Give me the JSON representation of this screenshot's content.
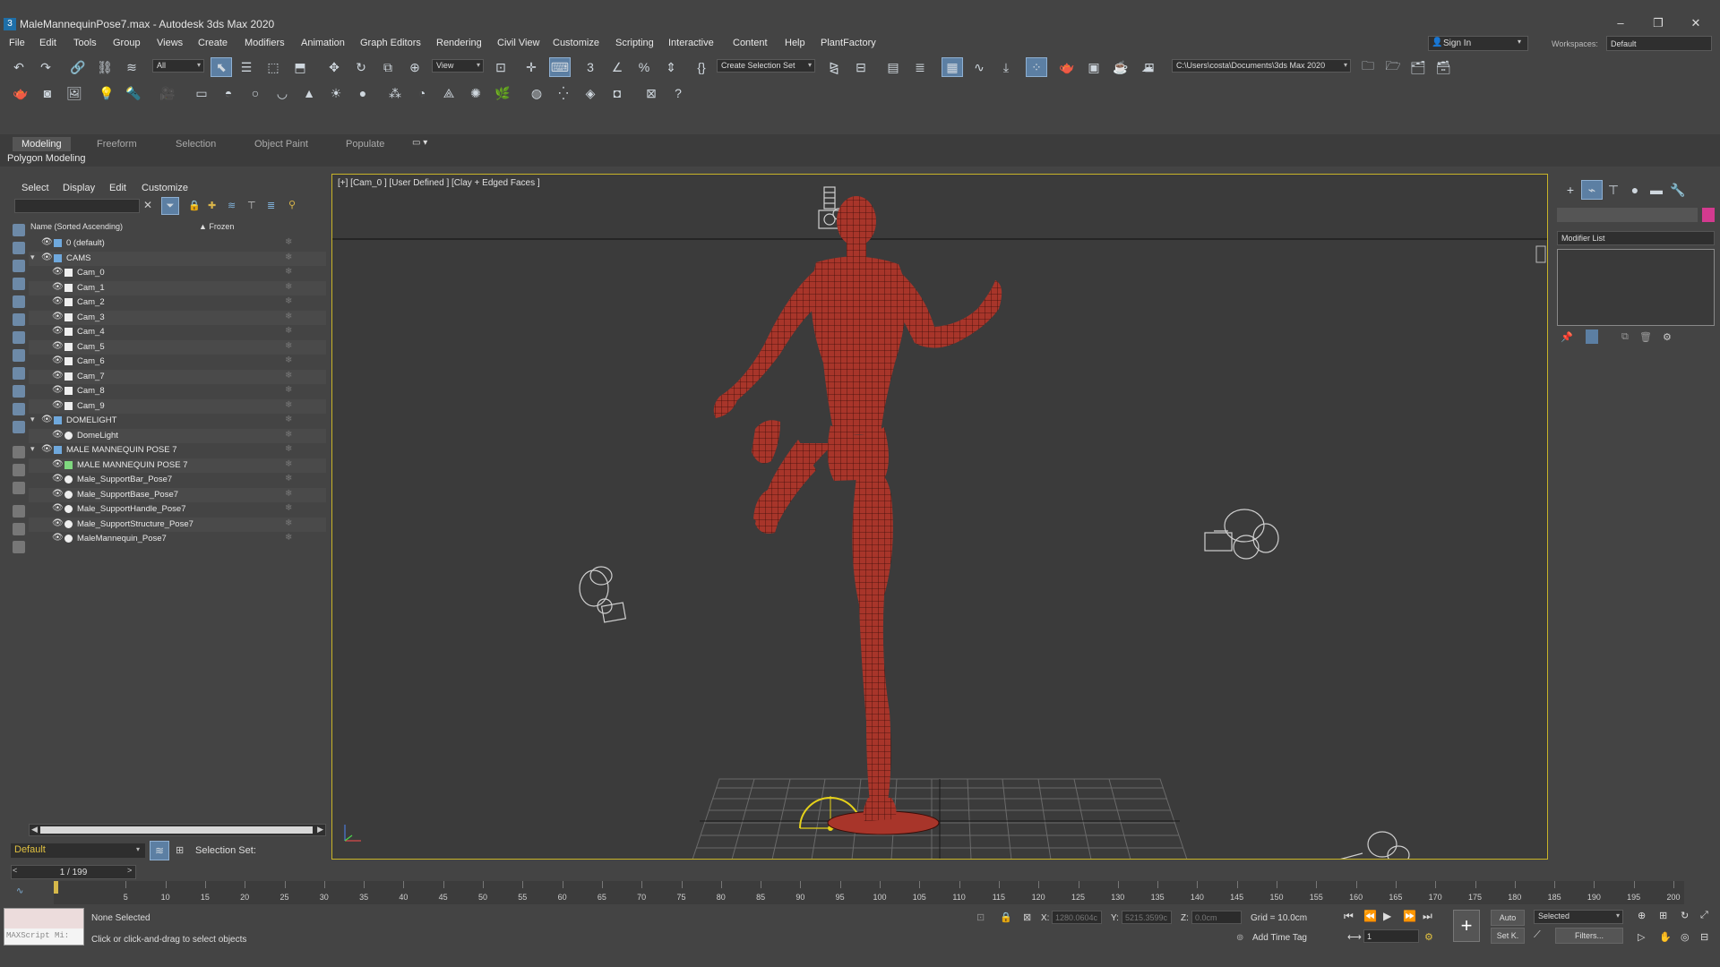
{
  "window": {
    "title": "MaleMannequinPose7.max - Autodesk 3ds Max 2020",
    "app_icon": "3",
    "controls": [
      "minimize-icon",
      "restore-icon",
      "close-icon"
    ]
  },
  "menu": [
    "File",
    "Edit",
    "Tools",
    "Group",
    "Views",
    "Create",
    "Modifiers",
    "Animation",
    "Graph Editors",
    "Rendering",
    "Civil View",
    "Customize",
    "Scripting",
    "Interactive",
    "Content",
    "Help",
    "PlantFactory"
  ],
  "account": {
    "sign_in": "Sign In"
  },
  "workspace": {
    "label": "Workspaces:",
    "value": "Default"
  },
  "main_toolbar": {
    "selection_filter": "All",
    "ref_coord": "View",
    "named_selection": "Create Selection Set",
    "project_path": "C:\\Users\\costa\\Documents\\3ds Max 2020"
  },
  "ribbon": {
    "tabs": [
      "Modeling",
      "Freeform",
      "Selection",
      "Object Paint",
      "Populate"
    ],
    "active_tab": "Modeling",
    "sub_label": "Polygon Modeling"
  },
  "scene_explorer": {
    "menu": [
      "Select",
      "Display",
      "Edit",
      "Customize"
    ],
    "column_name": "Name (Sorted Ascending)",
    "column_frozen": "▲ Frozen",
    "rows": [
      {
        "label": "0 (default)",
        "level": 0,
        "kind": "layer",
        "expand": ""
      },
      {
        "label": "CAMS",
        "level": 0,
        "kind": "layer",
        "expand": "▾"
      },
      {
        "label": "Cam_0",
        "level": 1,
        "kind": "camera",
        "expand": ""
      },
      {
        "label": "Cam_1",
        "level": 1,
        "kind": "camera",
        "expand": ""
      },
      {
        "label": "Cam_2",
        "level": 1,
        "kind": "camera",
        "expand": ""
      },
      {
        "label": "Cam_3",
        "level": 1,
        "kind": "camera",
        "expand": ""
      },
      {
        "label": "Cam_4",
        "level": 1,
        "kind": "camera",
        "expand": ""
      },
      {
        "label": "Cam_5",
        "level": 1,
        "kind": "camera",
        "expand": ""
      },
      {
        "label": "Cam_6",
        "level": 1,
        "kind": "camera",
        "expand": ""
      },
      {
        "label": "Cam_7",
        "level": 1,
        "kind": "camera",
        "expand": ""
      },
      {
        "label": "Cam_8",
        "level": 1,
        "kind": "camera",
        "expand": ""
      },
      {
        "label": "Cam_9",
        "level": 1,
        "kind": "camera",
        "expand": ""
      },
      {
        "label": "DOMELIGHT",
        "level": 0,
        "kind": "layer",
        "expand": "▾"
      },
      {
        "label": "DomeLight",
        "level": 1,
        "kind": "light",
        "expand": ""
      },
      {
        "label": "MALE MANNEQUIN POSE 7",
        "level": 0,
        "kind": "layer",
        "expand": "▾"
      },
      {
        "label": "MALE MANNEQUIN POSE 7",
        "level": 1,
        "kind": "group",
        "expand": ""
      },
      {
        "label": "Male_SupportBar_Pose7",
        "level": 1,
        "kind": "object",
        "expand": ""
      },
      {
        "label": "Male_SupportBase_Pose7",
        "level": 1,
        "kind": "object",
        "expand": ""
      },
      {
        "label": "Male_SupportHandle_Pose7",
        "level": 1,
        "kind": "object",
        "expand": ""
      },
      {
        "label": "Male_SupportStructure_Pose7",
        "level": 1,
        "kind": "object",
        "expand": ""
      },
      {
        "label": "MaleMannequin_Pose7",
        "level": 1,
        "kind": "object",
        "expand": ""
      }
    ],
    "layer": "Default",
    "selection_set_label": "Selection Set:"
  },
  "viewport": {
    "label": "[+] [Cam_0 ] [User Defined ] [Clay + Edged Faces ]",
    "mesh_color": "#a8352a",
    "wire_color": "#3a0d08",
    "frame_color": "#c8b428"
  },
  "command_panel": {
    "modifier_list": "Modifier List",
    "object_color": "#d33a8f",
    "tabs": [
      "create-icon",
      "modify-icon",
      "hierarchy-icon",
      "motion-icon",
      "display-icon",
      "utilities-icon"
    ]
  },
  "timeline": {
    "frame": "1 / 199",
    "ticks": [
      5,
      10,
      15,
      20,
      25,
      30,
      35,
      40,
      45,
      50,
      55,
      60,
      65,
      70,
      75,
      80,
      85,
      90,
      95,
      100,
      105,
      110,
      115,
      120,
      125,
      130,
      135,
      140,
      145,
      150,
      155,
      160,
      165,
      170,
      175,
      180,
      185,
      190,
      195,
      200
    ]
  },
  "status": {
    "maxscript": "MAXScript Mi:",
    "selection": "None Selected",
    "prompt": "Click or click-and-drag to select objects",
    "x": "1280.0604c",
    "y": "5215.3599c",
    "z": "0.0cm",
    "grid": "Grid = 10.0cm",
    "time_tag": "Add Time Tag",
    "auto": "Auto",
    "set_key": "Set K.",
    "key_filter": "Selected",
    "filters": "Filters...",
    "current_frame": "1"
  }
}
